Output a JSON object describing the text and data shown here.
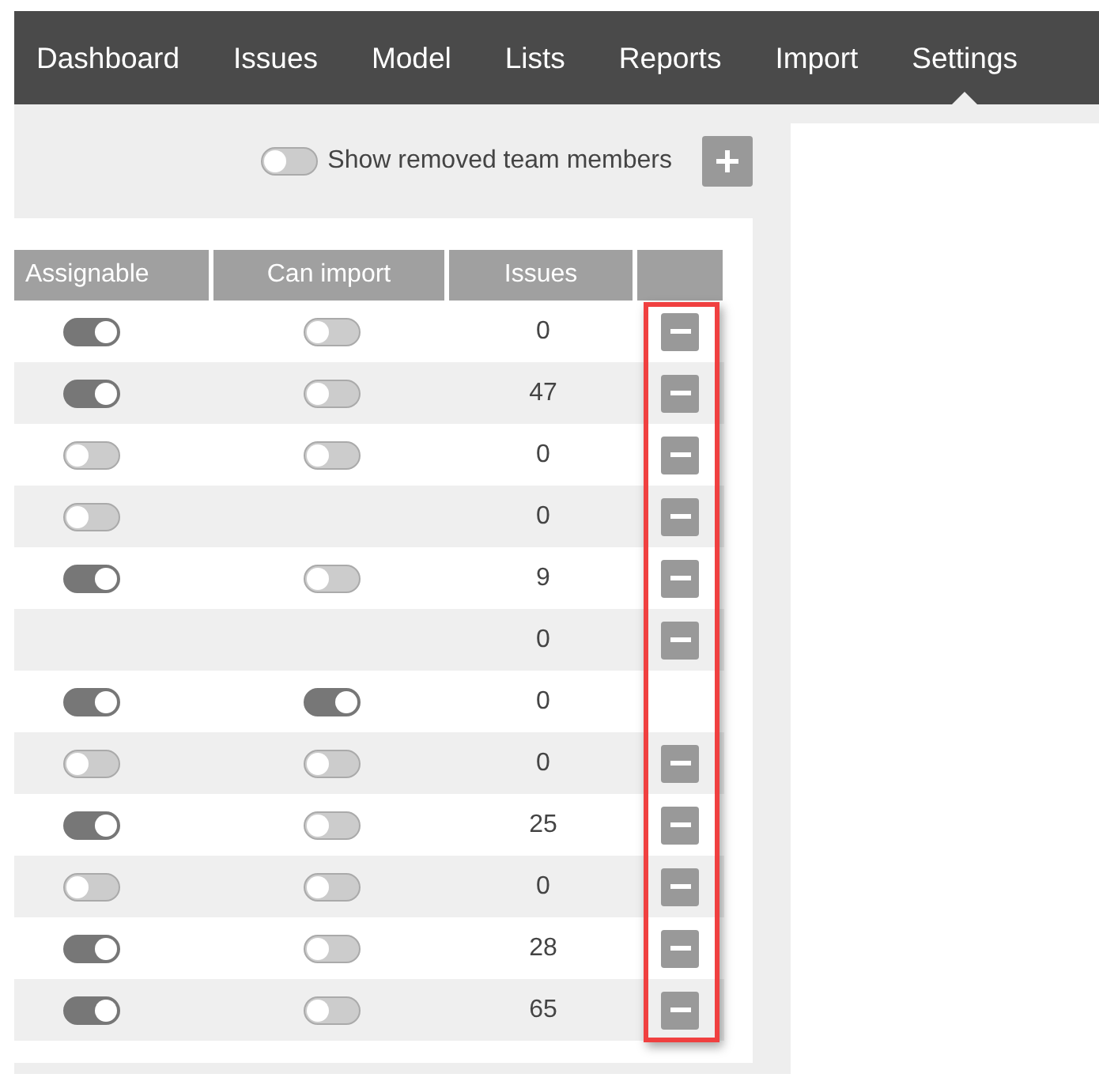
{
  "nav": [
    {
      "label": "Dashboard",
      "selected": false
    },
    {
      "label": "Issues",
      "selected": false
    },
    {
      "label": "Model",
      "selected": false
    },
    {
      "label": "Lists",
      "selected": false
    },
    {
      "label": "Reports",
      "selected": false
    },
    {
      "label": "Import",
      "selected": false
    },
    {
      "label": "Settings",
      "selected": true
    }
  ],
  "toolbar": {
    "show_removed": {
      "label": "Show removed team members",
      "on": false
    }
  },
  "table": {
    "columns": [
      "Assignable",
      "Can import",
      "Issues"
    ],
    "rows": [
      {
        "assignable": true,
        "can_import": false,
        "issues": "0",
        "removable": true
      },
      {
        "assignable": true,
        "can_import": false,
        "issues": "47",
        "removable": true
      },
      {
        "assignable": false,
        "can_import": false,
        "issues": "0",
        "removable": true
      },
      {
        "assignable": false,
        "issues": "0",
        "removable": true
      },
      {
        "assignable": true,
        "can_import": false,
        "issues": "9",
        "removable": true
      },
      {
        "issues": "0",
        "removable": true
      },
      {
        "assignable": true,
        "can_import": true,
        "issues": "0",
        "removable": false
      },
      {
        "assignable": false,
        "can_import": false,
        "issues": "0",
        "removable": true
      },
      {
        "assignable": true,
        "can_import": false,
        "issues": "25",
        "removable": true
      },
      {
        "assignable": false,
        "can_import": false,
        "issues": "0",
        "removable": true
      },
      {
        "assignable": true,
        "can_import": false,
        "issues": "28",
        "removable": true
      },
      {
        "assignable": true,
        "can_import": false,
        "issues": "65",
        "removable": true
      }
    ]
  }
}
